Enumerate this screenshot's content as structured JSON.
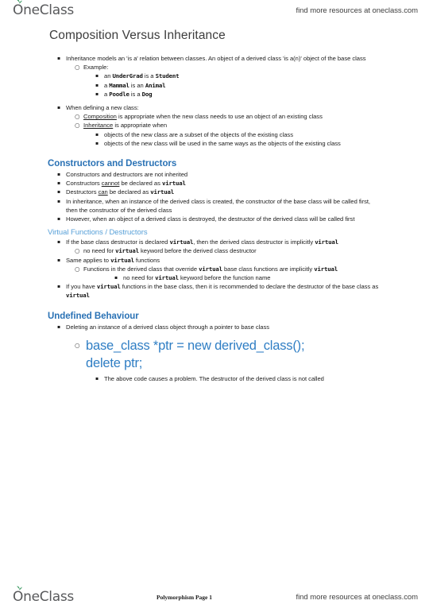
{
  "brand": {
    "logo_text_o": "O",
    "logo_text_rest": "neClass",
    "sprout_color": "#1d8a4a",
    "promo_text": "find more resources at oneclass.com",
    "footer_center": "Polymorphism Page 1"
  },
  "document": {
    "title": "Composition Versus Inheritance",
    "colors": {
      "section_heading": "#2a72b5",
      "subsection_heading": "#57a0d8",
      "code_callout": "#2f7ec4",
      "body_text": "#1d1d1d",
      "title_text": "#3d3d3d"
    },
    "intro": {
      "b1": {
        "text_a": "Inheritance models an 'is a' relation between classes. An object of a derived class 'is a(n)' object of the base class",
        "example_label": "Example:",
        "examples": [
          {
            "pre": "an ",
            "code1": "UnderGrad",
            "mid": " is a ",
            "code2": "Student",
            "post": ""
          },
          {
            "pre": "a ",
            "code1": "Mammal",
            "mid": " is an ",
            "code2": "Animal",
            "post": ""
          },
          {
            "pre": "a ",
            "code1": "Poodle",
            "mid": " is a ",
            "code2": "Dog",
            "post": ""
          }
        ]
      },
      "b2": {
        "text": "When defining a new class:",
        "composition_term": "Composition",
        "composition_rest": " is appropriate when the new class needs to use an object of an existing class",
        "inheritance_term": "Inheritance",
        "inheritance_rest": " is appropriate when",
        "inheritance_points": [
          "objects of the new class are a subset of the objects of the existing class",
          "objects of the new class will be used in the same ways as the objects of the existing class"
        ]
      }
    },
    "constructors_section": {
      "heading": "Constructors and Destructors",
      "p1": "Constructors and destructors are not inherited",
      "p2_pre": "Constructors ",
      "p2_emph": "cannot",
      "p2_mid": " be declared as ",
      "p2_code": "virtual",
      "p3_pre": "Destructors ",
      "p3_emph": "can",
      "p3_mid": " be declared as ",
      "p3_code": "virtual",
      "p4": "In inheritance, when an instance of the derived class is created, the constructor of the base class will be called first, then the constructor of the derived class",
      "p5": "However, when an object of a derived class is destroyed, the destructor of the derived class will be called first"
    },
    "virtual_subsection": {
      "heading": "Virtual Functions / Destructors",
      "p1_pre": "If the base class destructor is declared ",
      "p1_code1": "virtual",
      "p1_mid": ", then the derived class destructor is implicitly ",
      "p1_code2": "virtual",
      "p1_sub_pre": "no need for ",
      "p1_sub_code": "virtual",
      "p1_sub_post": " keyword before the derived class destructor",
      "p2_pre": "Same applies to ",
      "p2_code": "virtual",
      "p2_post": " functions",
      "p2_sub_pre": "Functions in the derived class that override ",
      "p2_sub_code1": "virtual",
      "p2_sub_mid": " base class functions are implicitly ",
      "p2_sub_code2": "virtual",
      "p2_subsub_pre": "no need for ",
      "p2_subsub_code": "virtual",
      "p2_subsub_post": " keyword before the function name",
      "p3_pre": "If you have ",
      "p3_code1": "virtual",
      "p3_mid": " functions in the base class, then it is recommended to declare the destructor of the base class as ",
      "p3_code2": "virtual"
    },
    "undefined_section": {
      "heading": "Undefined Behaviour",
      "p1": "Deleting an instance of a derived class object through a pointer to base class",
      "code_line1": "base_class *ptr = new derived_class();",
      "code_line2": "delete ptr;",
      "note": "The above code causes a problem. The destructor of the derived class is not called"
    }
  },
  "icons": {
    "bullet_square": "▪",
    "bullet_circle": "○"
  }
}
